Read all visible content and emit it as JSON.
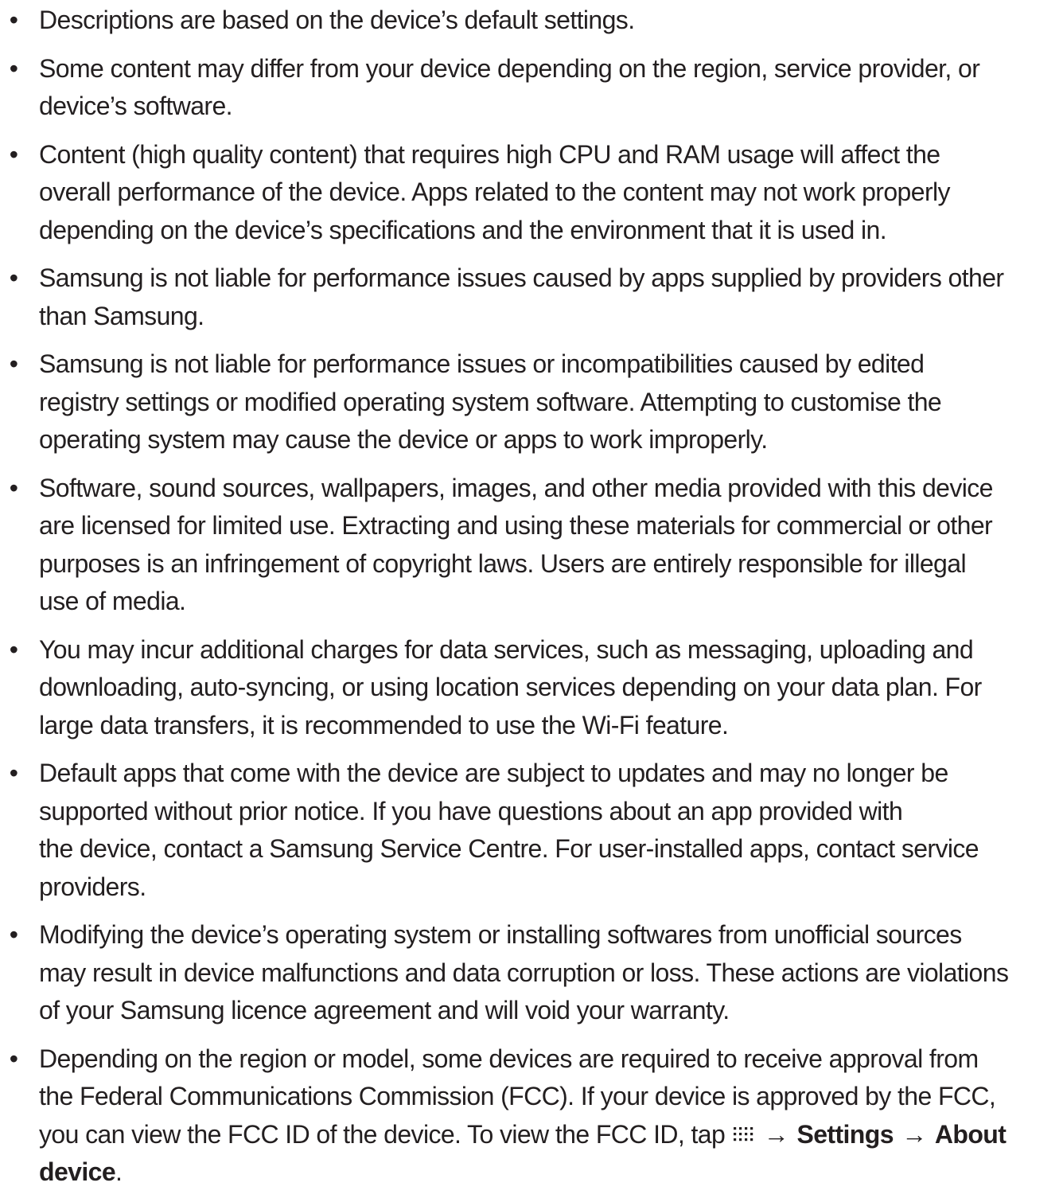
{
  "notices": [
    {
      "lines": [
        "Descriptions are based on the device’s default settings."
      ]
    },
    {
      "lines": [
        "Some content may differ from your device depending on the region, service provider, or",
        "device’s software."
      ]
    },
    {
      "lines": [
        "Content (high quality content) that requires high CPU and RAM usage will affect the",
        "overall performance of the device. Apps related to the content may not work properly",
        "depending on the device’s specifications and the environment that it is used in."
      ]
    },
    {
      "lines": [
        "Samsung is not liable for performance issues caused by apps supplied by providers other",
        "than Samsung."
      ]
    },
    {
      "lines": [
        "Samsung is not liable for performance issues or incompatibilities caused by edited",
        "registry settings or modified operating system software. Attempting to customise the",
        "operating system may cause the device or apps to work improperly."
      ]
    },
    {
      "lines": [
        "Software, sound sources, wallpapers, images, and other media provided with this device",
        "are licensed for limited use. Extracting and using these materials for commercial or other",
        "purposes is an infringement of copyright laws. Users are entirely responsible for illegal",
        "use of media."
      ]
    },
    {
      "lines": [
        "You may incur additional charges for data services, such as messaging, uploading and",
        "downloading, auto-syncing, or using location services depending on your data plan. For",
        "large data transfers, it is recommended to use the Wi-Fi feature."
      ]
    },
    {
      "lines": [
        "Default apps that come with the device are subject to updates and may no longer be",
        "supported without prior notice. If you have questions about an app provided with",
        "the device, contact a Samsung Service Centre. For user-installed apps, contact service",
        "providers."
      ]
    },
    {
      "lines": [
        "Modifying the device’s operating system or installing softwares from unofficial sources",
        "may result in device malfunctions and data corruption or loss. These actions are violations",
        "of your Samsung licence agreement and will void your warranty."
      ]
    },
    {
      "lines": [
        "Depending on the region or model, some devices are required to receive approval from",
        "the Federal Communications Commission (FCC). If your device is approved by the FCC,"
      ]
    }
  ],
  "fcc_last": {
    "text_before": "you can view the FCC ID of the device. To view the FCC ID, tap",
    "arrow1": "→",
    "settings": "Settings",
    "arrow2": "→",
    "about": "About",
    "device": "device",
    "period": "."
  },
  "bullet": "•",
  "icons": {
    "apps": "apps-grid-icon"
  }
}
